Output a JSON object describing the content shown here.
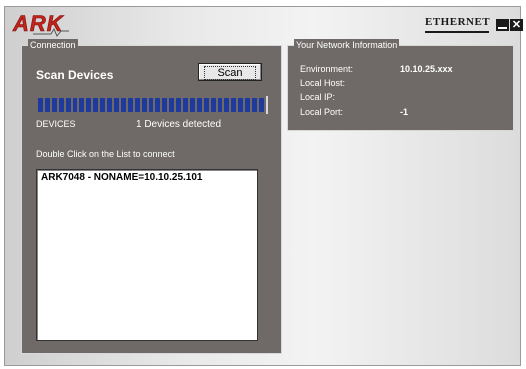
{
  "titlebar": {
    "logo_text": "ARK",
    "connection_type": "ETHERNET",
    "minimize_icon": "minimize-icon",
    "close_icon": "close-icon",
    "close_glyph": "✕"
  },
  "connection": {
    "legend": "Connection",
    "title": "Scan Devices",
    "scan_button": "Scan",
    "progress": {
      "segments": 33,
      "fraction": 1.0,
      "color": "#1d3a9c"
    },
    "devices_label": "DEVICES",
    "devices_count": "1 Devices detected",
    "hint": "Double Click on the List to connect",
    "devices": [
      {
        "label": "ARK7048 - NONAME=10.10.25.101"
      }
    ]
  },
  "network": {
    "legend": "Your Network Information",
    "rows": [
      {
        "label": "Environment:",
        "value": "10.10.25.xxx"
      },
      {
        "label": "Local Host:",
        "value": ""
      },
      {
        "label": "Local IP:",
        "value": ""
      },
      {
        "label": "Local Port:",
        "value": "-1"
      }
    ]
  },
  "colors": {
    "panel_bg": "#6f6a67",
    "logo_red": "#c2241c",
    "accent_blue": "#1d3a9c"
  }
}
